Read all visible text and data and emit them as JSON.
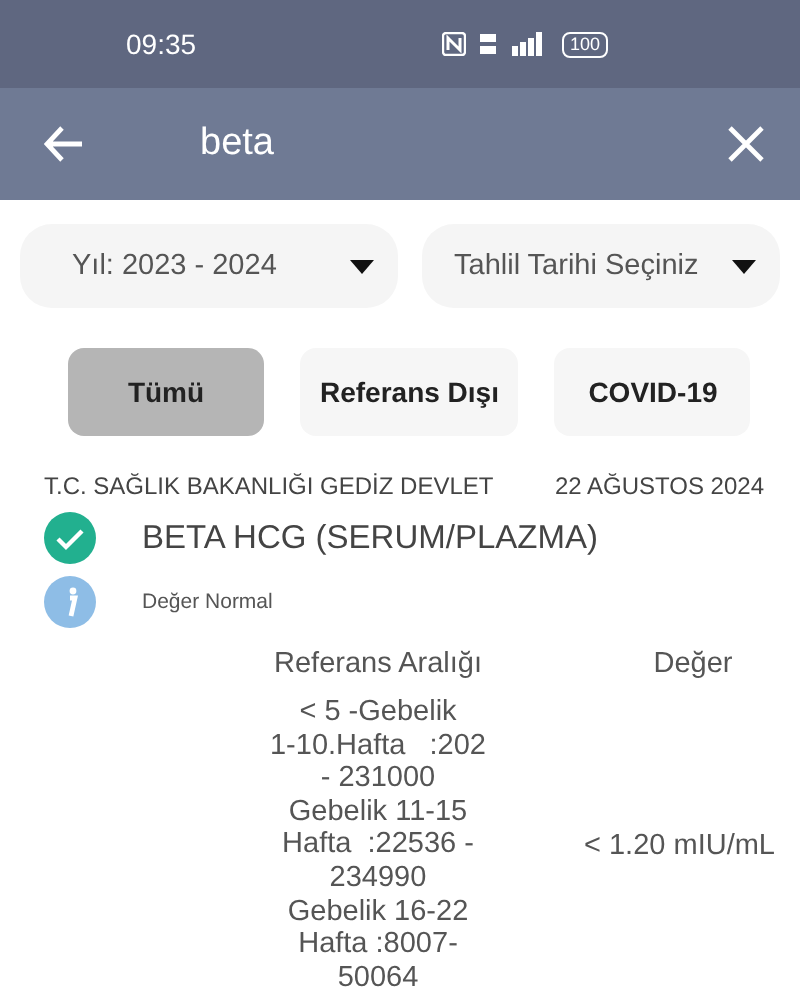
{
  "status_bar": {
    "time": "09:35",
    "battery": "100"
  },
  "search_bar": {
    "value": "beta"
  },
  "dropdowns": [
    {
      "label": "Yıl: 2023 - 2024"
    },
    {
      "label": "Tahlil Tarihi Seçiniz"
    }
  ],
  "filters": [
    {
      "label": "Tümü",
      "selected": true
    },
    {
      "label": "Referans Dışı",
      "selected": false
    },
    {
      "label": "COVID-19",
      "selected": false
    }
  ],
  "results": [
    {
      "hospital": "T.C. SAĞLIK BAKANLIĞI GEDİZ DEVLET",
      "date": "22 AĞUSTOS 2024",
      "test": "BETA HCG (SERUM/PLAZMA)",
      "note": "Değer Normal",
      "columns": [
        "Referans Aralığı",
        "Değer"
      ],
      "reference": "< 5 -Gebelik\n1-10.Hafta   :202\n- 231000\nGebelik 11-15\nHafta  :22536 -\n234990\nGebelik 16-22\nHafta :8007-\n50064",
      "value": "< 1.20 mIU/mL"
    }
  ]
}
